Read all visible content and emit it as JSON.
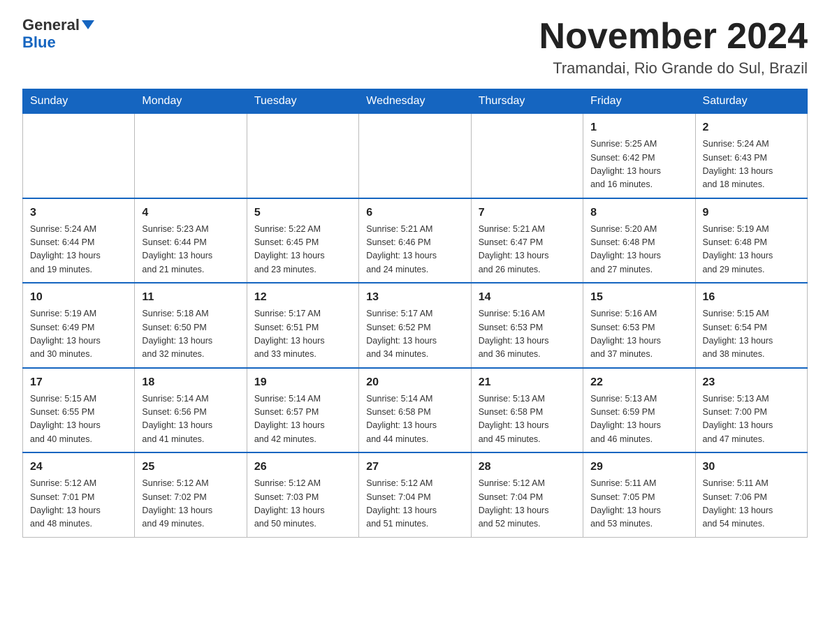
{
  "header": {
    "logo_general": "General",
    "logo_blue": "Blue",
    "month_title": "November 2024",
    "location": "Tramandai, Rio Grande do Sul, Brazil"
  },
  "weekdays": [
    "Sunday",
    "Monday",
    "Tuesday",
    "Wednesday",
    "Thursday",
    "Friday",
    "Saturday"
  ],
  "weeks": [
    [
      {
        "day": "",
        "info": ""
      },
      {
        "day": "",
        "info": ""
      },
      {
        "day": "",
        "info": ""
      },
      {
        "day": "",
        "info": ""
      },
      {
        "day": "",
        "info": ""
      },
      {
        "day": "1",
        "info": "Sunrise: 5:25 AM\nSunset: 6:42 PM\nDaylight: 13 hours\nand 16 minutes."
      },
      {
        "day": "2",
        "info": "Sunrise: 5:24 AM\nSunset: 6:43 PM\nDaylight: 13 hours\nand 18 minutes."
      }
    ],
    [
      {
        "day": "3",
        "info": "Sunrise: 5:24 AM\nSunset: 6:44 PM\nDaylight: 13 hours\nand 19 minutes."
      },
      {
        "day": "4",
        "info": "Sunrise: 5:23 AM\nSunset: 6:44 PM\nDaylight: 13 hours\nand 21 minutes."
      },
      {
        "day": "5",
        "info": "Sunrise: 5:22 AM\nSunset: 6:45 PM\nDaylight: 13 hours\nand 23 minutes."
      },
      {
        "day": "6",
        "info": "Sunrise: 5:21 AM\nSunset: 6:46 PM\nDaylight: 13 hours\nand 24 minutes."
      },
      {
        "day": "7",
        "info": "Sunrise: 5:21 AM\nSunset: 6:47 PM\nDaylight: 13 hours\nand 26 minutes."
      },
      {
        "day": "8",
        "info": "Sunrise: 5:20 AM\nSunset: 6:48 PM\nDaylight: 13 hours\nand 27 minutes."
      },
      {
        "day": "9",
        "info": "Sunrise: 5:19 AM\nSunset: 6:48 PM\nDaylight: 13 hours\nand 29 minutes."
      }
    ],
    [
      {
        "day": "10",
        "info": "Sunrise: 5:19 AM\nSunset: 6:49 PM\nDaylight: 13 hours\nand 30 minutes."
      },
      {
        "day": "11",
        "info": "Sunrise: 5:18 AM\nSunset: 6:50 PM\nDaylight: 13 hours\nand 32 minutes."
      },
      {
        "day": "12",
        "info": "Sunrise: 5:17 AM\nSunset: 6:51 PM\nDaylight: 13 hours\nand 33 minutes."
      },
      {
        "day": "13",
        "info": "Sunrise: 5:17 AM\nSunset: 6:52 PM\nDaylight: 13 hours\nand 34 minutes."
      },
      {
        "day": "14",
        "info": "Sunrise: 5:16 AM\nSunset: 6:53 PM\nDaylight: 13 hours\nand 36 minutes."
      },
      {
        "day": "15",
        "info": "Sunrise: 5:16 AM\nSunset: 6:53 PM\nDaylight: 13 hours\nand 37 minutes."
      },
      {
        "day": "16",
        "info": "Sunrise: 5:15 AM\nSunset: 6:54 PM\nDaylight: 13 hours\nand 38 minutes."
      }
    ],
    [
      {
        "day": "17",
        "info": "Sunrise: 5:15 AM\nSunset: 6:55 PM\nDaylight: 13 hours\nand 40 minutes."
      },
      {
        "day": "18",
        "info": "Sunrise: 5:14 AM\nSunset: 6:56 PM\nDaylight: 13 hours\nand 41 minutes."
      },
      {
        "day": "19",
        "info": "Sunrise: 5:14 AM\nSunset: 6:57 PM\nDaylight: 13 hours\nand 42 minutes."
      },
      {
        "day": "20",
        "info": "Sunrise: 5:14 AM\nSunset: 6:58 PM\nDaylight: 13 hours\nand 44 minutes."
      },
      {
        "day": "21",
        "info": "Sunrise: 5:13 AM\nSunset: 6:58 PM\nDaylight: 13 hours\nand 45 minutes."
      },
      {
        "day": "22",
        "info": "Sunrise: 5:13 AM\nSunset: 6:59 PM\nDaylight: 13 hours\nand 46 minutes."
      },
      {
        "day": "23",
        "info": "Sunrise: 5:13 AM\nSunset: 7:00 PM\nDaylight: 13 hours\nand 47 minutes."
      }
    ],
    [
      {
        "day": "24",
        "info": "Sunrise: 5:12 AM\nSunset: 7:01 PM\nDaylight: 13 hours\nand 48 minutes."
      },
      {
        "day": "25",
        "info": "Sunrise: 5:12 AM\nSunset: 7:02 PM\nDaylight: 13 hours\nand 49 minutes."
      },
      {
        "day": "26",
        "info": "Sunrise: 5:12 AM\nSunset: 7:03 PM\nDaylight: 13 hours\nand 50 minutes."
      },
      {
        "day": "27",
        "info": "Sunrise: 5:12 AM\nSunset: 7:04 PM\nDaylight: 13 hours\nand 51 minutes."
      },
      {
        "day": "28",
        "info": "Sunrise: 5:12 AM\nSunset: 7:04 PM\nDaylight: 13 hours\nand 52 minutes."
      },
      {
        "day": "29",
        "info": "Sunrise: 5:11 AM\nSunset: 7:05 PM\nDaylight: 13 hours\nand 53 minutes."
      },
      {
        "day": "30",
        "info": "Sunrise: 5:11 AM\nSunset: 7:06 PM\nDaylight: 13 hours\nand 54 minutes."
      }
    ]
  ]
}
